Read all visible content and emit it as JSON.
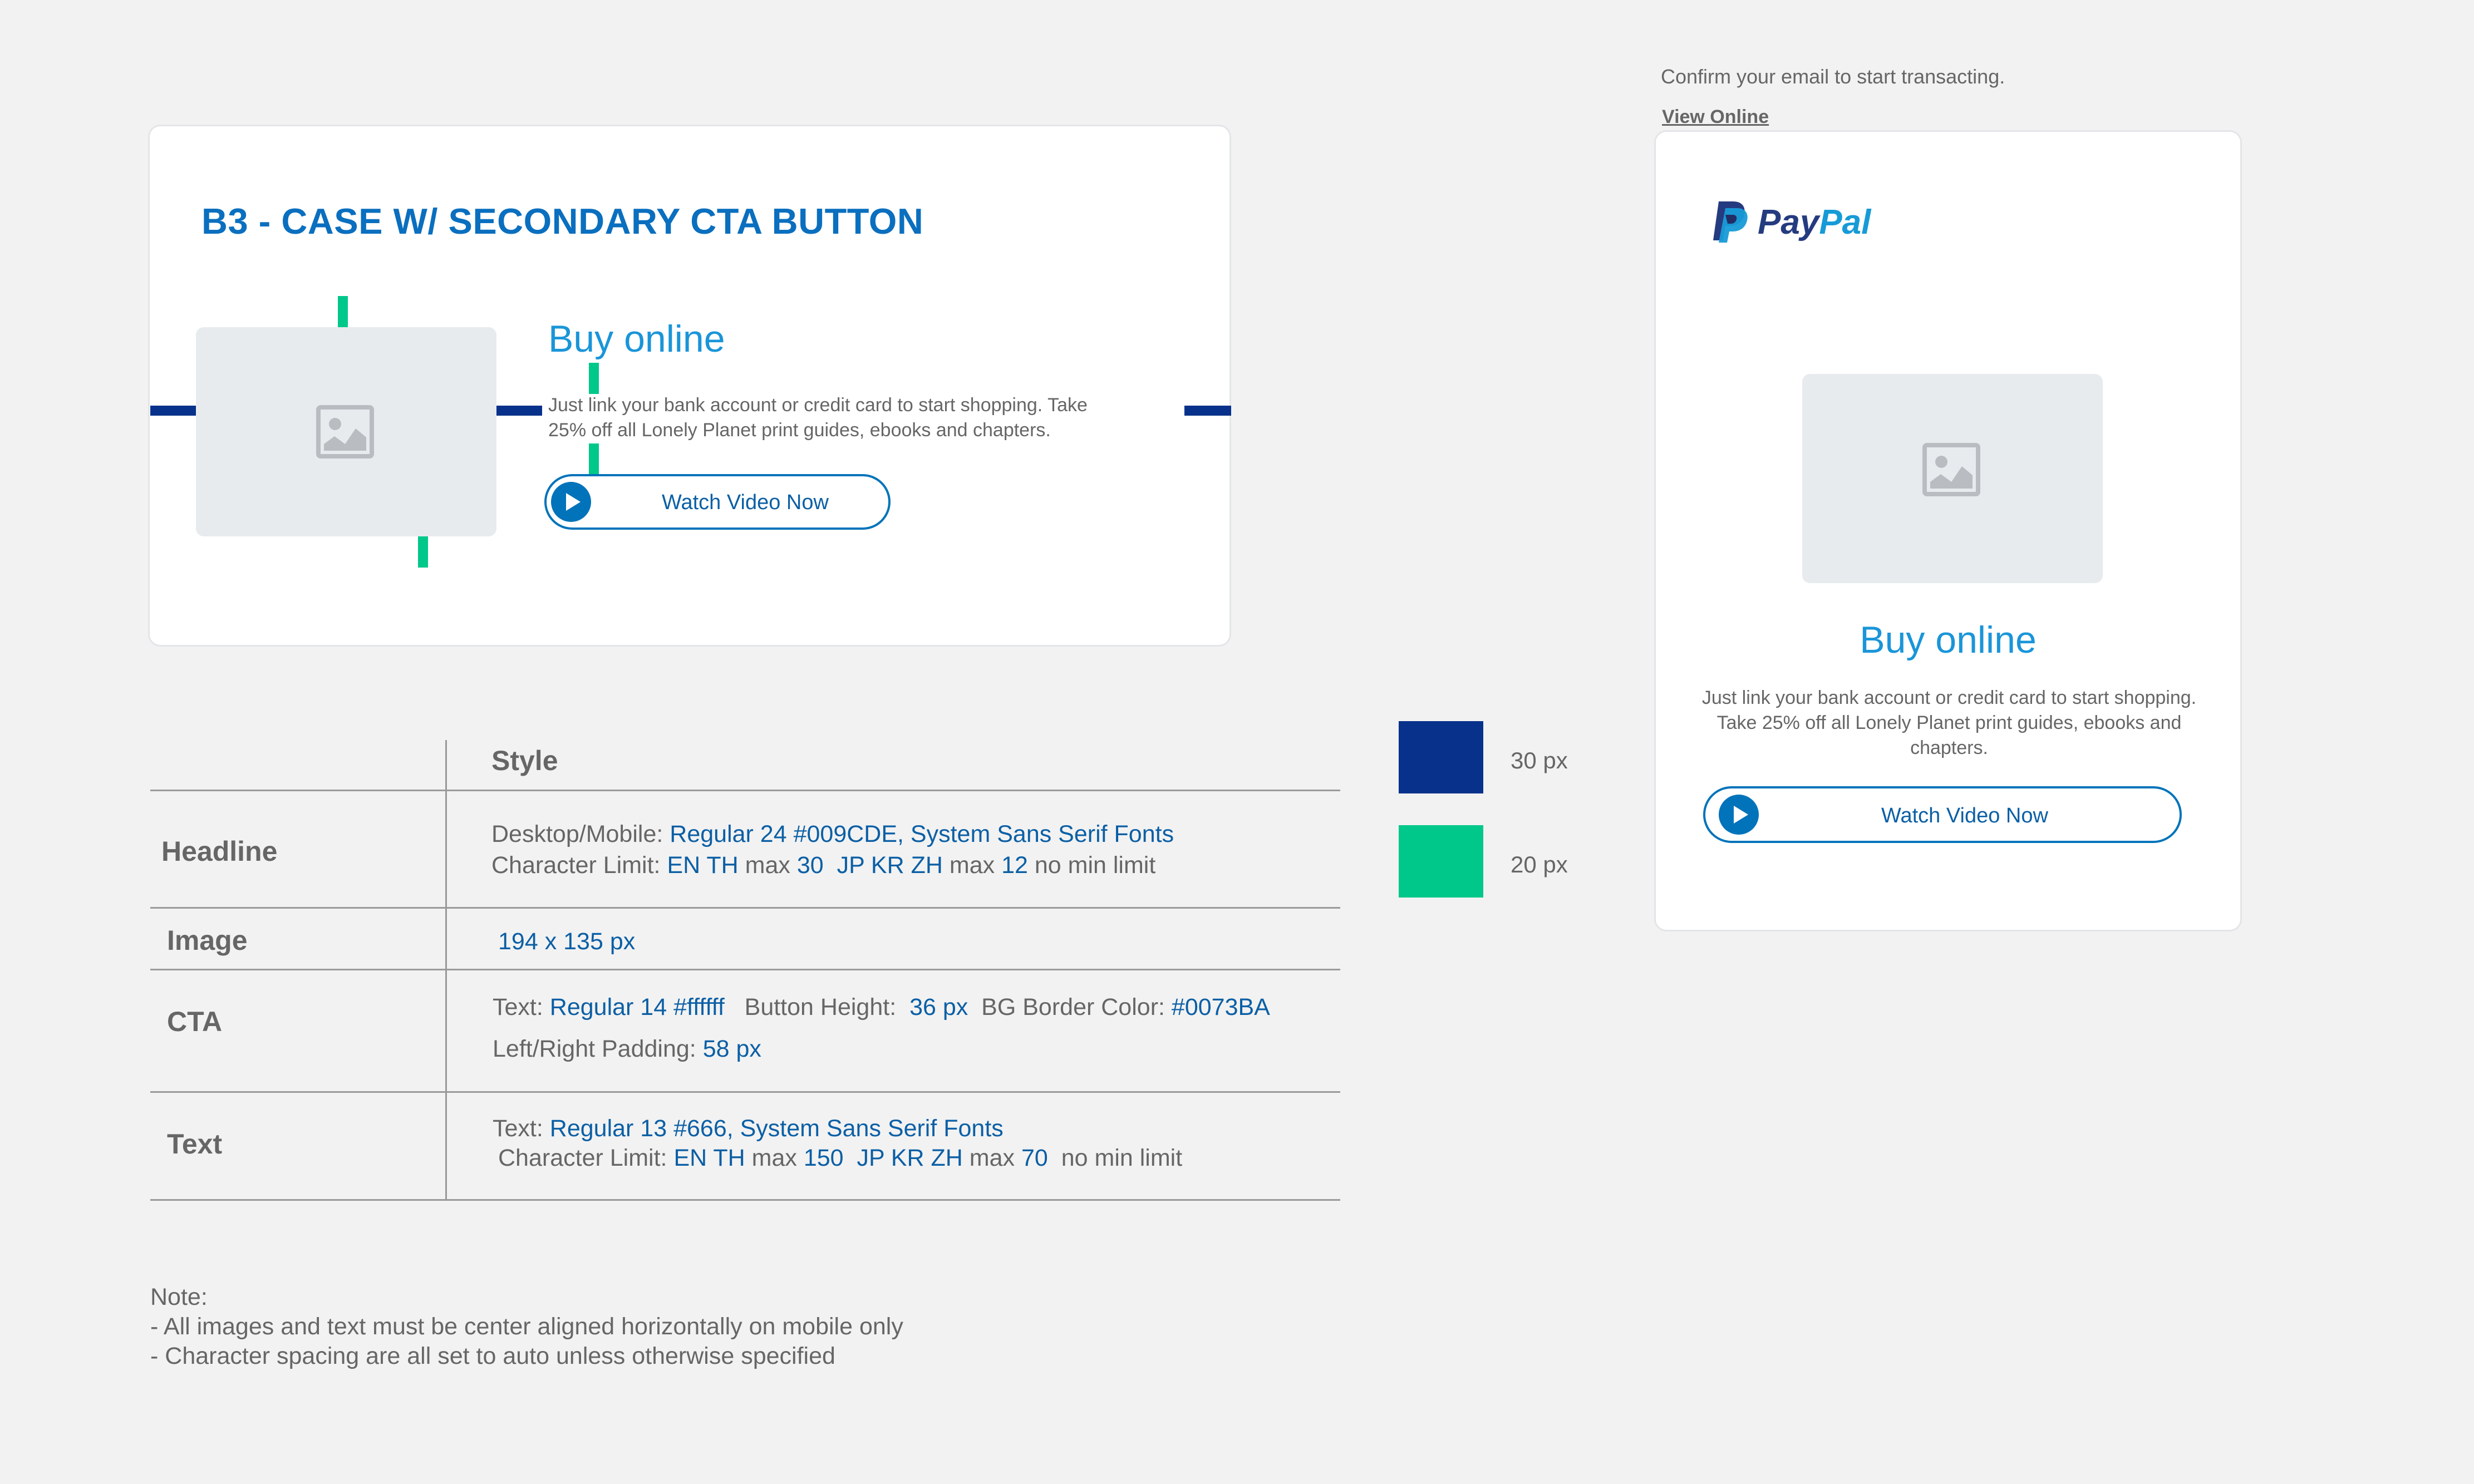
{
  "desktop": {
    "section_title": "B3 - CASE W/ SECONDARY CTA BUTTON",
    "headline": "Buy online",
    "body": "Just link your bank account or credit card to start shopping. Take 25% off all Lonely Planet print guides, ebooks and chapters.",
    "cta_label": "Watch Video Now",
    "image_icon": "image-placeholder-icon"
  },
  "mobile": {
    "header_text": "Confirm your email to start transacting.",
    "view_online": "View Online",
    "logo": {
      "pay": "Pay",
      "pal": "Pal"
    },
    "headline": "Buy online",
    "body": "Just link your bank account or credit card to start shopping. Take 25% off all Lonely Planet print guides, ebooks and chapters.",
    "cta_label": "Watch Video Now",
    "image_icon": "image-placeholder-icon"
  },
  "legend": {
    "blue_label": "30 px",
    "green_label": "20 px",
    "blue_color": "#07318A",
    "green_color": "#00C88A"
  },
  "spec_table": {
    "header": "Style",
    "headline": {
      "label": "Headline",
      "line1": {
        "prefix": "Desktop/Mobile: ",
        "value": "Regular 24 #009CDE, System Sans Serif Fonts"
      },
      "line2": {
        "prefix": "Character Limit: ",
        "en": "EN TH",
        "max1_word": " max ",
        "max1": "30",
        "jp": "JP KR ZH",
        "max2_word": " max ",
        "max2": "12",
        "suffix": " no min limit"
      }
    },
    "image": {
      "label": "Image",
      "value": "194 x 135 px"
    },
    "cta": {
      "label": "CTA",
      "line1": {
        "text_prefix": "Text: ",
        "text_value": "Regular 14 #ffffff",
        "height_prefix": "Button Height:",
        "height_value": "36 px",
        "border_prefix": "BG Border Color: ",
        "border_value": "#0073BA"
      },
      "line2": {
        "prefix": "Left/Right Padding: ",
        "value": "58 px"
      }
    },
    "text": {
      "label": "Text",
      "line1": {
        "prefix": "Text: ",
        "value": "Regular 13 #666, System Sans Serif Fonts"
      },
      "line2": {
        "prefix": "Character Limit: ",
        "en": "EN TH",
        "max1_word": " max ",
        "max1": "150",
        "jp": "JP KR ZH",
        "max2_word": " max ",
        "max2": "70",
        "suffix": "no min limit"
      }
    }
  },
  "notes": {
    "title": "Note:",
    "line1": "- All images and text must be center aligned horizontally on mobile only",
    "line2": "- Character spacing are all set to auto unless otherwise specified"
  },
  "colors": {
    "accent_headline": "#009CDE",
    "cta_border": "#0073BA",
    "body_text": "#666666",
    "section_title": "#0A6FBF"
  }
}
